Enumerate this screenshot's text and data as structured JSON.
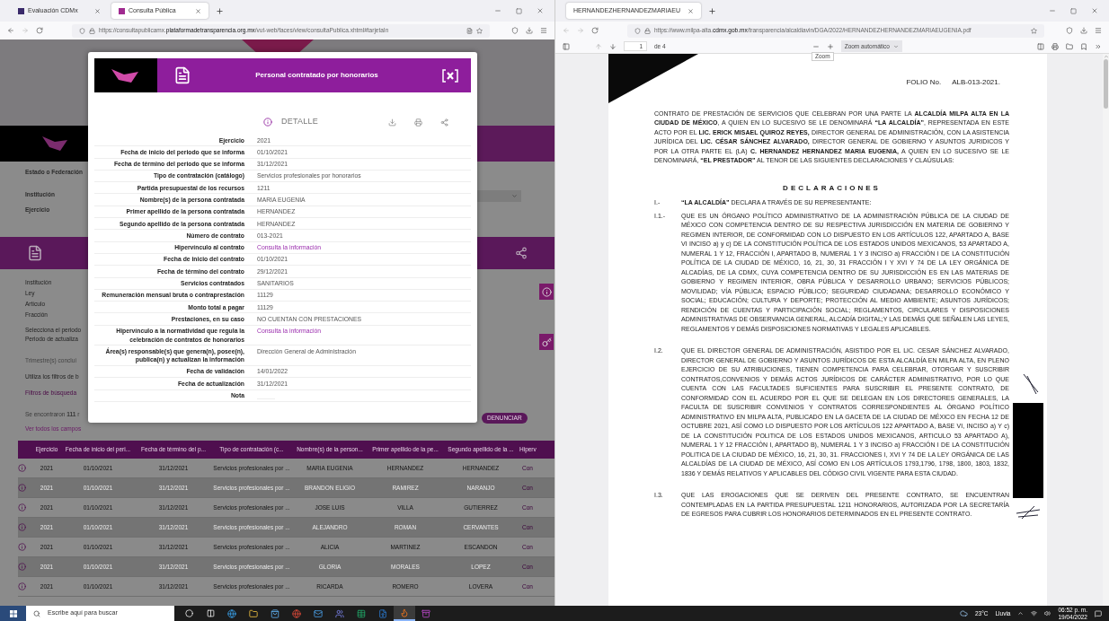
{
  "left_window": {
    "tabs": [
      {
        "label": "Evaluación CDMx",
        "selected": false
      },
      {
        "label": "Consulta Pública",
        "selected": true
      }
    ],
    "address": {
      "prefix": "https://consultapublicamx.",
      "domain": "plataformadetransparencia.org.mx",
      "path": "/vut-web/faces/view/consultaPublica.xhtml#tarjetaIn"
    },
    "page": {
      "filters": [
        "Estado o Federación",
        "Institución",
        "Ejercicio"
      ],
      "info_labels": [
        "Institución",
        "Ley",
        "Artículo",
        "Fracción"
      ],
      "period_lines": [
        "Selecciona el periodo",
        "Periodo de actualiza"
      ],
      "notes": [
        {
          "text": "Trimestre(s) conclui",
          "kind": "muted"
        },
        {
          "text": "Utiliza los filtros de b",
          "kind": "plain"
        },
        {
          "text": "Filtros de búsqueda",
          "kind": "link"
        }
      ],
      "results": "Se encontraron **111** r",
      "report_button": "DENUNCIAR",
      "view_all_link": "Ver todos los campos",
      "table": {
        "columns": [
          "Ejercicio",
          "Fecha de inicio del peri...",
          "Fecha de término del p...",
          "Tipo de contratación (c...",
          "Nombre(s) de la person...",
          "Primer apellido de la pe...",
          "Segundo apellido de la ...",
          "Hiperv"
        ],
        "rows": [
          {
            "faded": false,
            "cells": [
              "2021",
              "01/10/2021",
              "31/12/2021",
              "Servicios profesionales por ...",
              "MARIA EUGENIA",
              "HERNANDEZ",
              "HERNANDEZ",
              "Con"
            ]
          },
          {
            "faded": true,
            "cells": [
              "2021",
              "01/10/2021",
              "31/12/2021",
              "Servicios profesionales por ...",
              "BRANDON ELIGIO",
              "RAMIREZ",
              "NARANJO",
              "Con"
            ]
          },
          {
            "faded": false,
            "cells": [
              "2021",
              "01/10/2021",
              "31/12/2021",
              "Servicios profesionales por ...",
              "JOSE LUIS",
              "VILLA",
              "GUTIERREZ",
              "Con"
            ]
          },
          {
            "faded": true,
            "cells": [
              "2021",
              "01/10/2021",
              "31/12/2021",
              "Servicios profesionales por ...",
              "ALEJANDRO",
              "ROMAN",
              "CERVANTES",
              "Con"
            ]
          },
          {
            "faded": false,
            "cells": [
              "2021",
              "01/10/2021",
              "31/12/2021",
              "Servicios profesionales por ...",
              "ALICIA",
              "MARTINEZ",
              "ESCANDON",
              "Con"
            ]
          },
          {
            "faded": true,
            "cells": [
              "2021",
              "01/10/2021",
              "31/12/2021",
              "Servicios profesionales por ...",
              "GLORIA",
              "MORALES",
              "LOPEZ",
              "Con"
            ]
          },
          {
            "faded": false,
            "cells": [
              "2021",
              "01/10/2021",
              "31/12/2021",
              "Servicios profesionales por ...",
              "RICARDA",
              "ROMERO",
              "LOVERA",
              "Con"
            ]
          }
        ]
      }
    },
    "modal": {
      "title": "Personal contratado por honorarios",
      "detail_heading": "DETALLE",
      "fields": [
        {
          "label": "Ejercicio",
          "value": "2021",
          "kind": "text"
        },
        {
          "label": "Fecha de inicio del periodo que se informa",
          "value": "01/10/2021",
          "kind": "text"
        },
        {
          "label": "Fecha de término del periodo que se informa",
          "value": "31/12/2021",
          "kind": "text"
        },
        {
          "label": "Tipo de contratación (catálogo)",
          "value": "Servicios profesionales por honorarios",
          "kind": "text"
        },
        {
          "label": "Partida presupuestal de los recursos",
          "value": "1211",
          "kind": "text"
        },
        {
          "label": "Nombre(s) de la persona contratada",
          "value": "MARIA EUGENIA",
          "kind": "text"
        },
        {
          "label": "Primer apellido de la persona contratada",
          "value": "HERNANDEZ",
          "kind": "text"
        },
        {
          "label": "Segundo apellido de la persona contratada",
          "value": "HERNANDEZ",
          "kind": "text"
        },
        {
          "label": "Número de contrato",
          "value": "013-2021",
          "kind": "text"
        },
        {
          "label": "Hipervínculo al contrato",
          "value": "Consulta la información",
          "kind": "link"
        },
        {
          "label": "Fecha de inicio del contrato",
          "value": "01/10/2021",
          "kind": "text"
        },
        {
          "label": "Fecha de término del contrato",
          "value": "29/12/2021",
          "kind": "text"
        },
        {
          "label": "Servicios contratados",
          "value": "SANITARIOS",
          "kind": "text"
        },
        {
          "label": "Remuneración mensual bruta o contraprestación",
          "value": "11129",
          "kind": "text"
        },
        {
          "label": "Monto total a pagar",
          "value": "11129",
          "kind": "text"
        },
        {
          "label": "Prestaciones, en su caso",
          "value": "NO CUENTAN CON PRESTACIONES",
          "kind": "text"
        },
        {
          "label": "Hipervínculo a la normatividad que regula la celebración de contratos de honorarios",
          "value": "Consulta la información",
          "kind": "link"
        },
        {
          "label": "Área(s) responsable(s) que genera(n), posee(n), publica(n) y actualizan la información",
          "value": "Dirección General de Administración",
          "kind": "text"
        },
        {
          "label": "Fecha de validación",
          "value": "14/01/2022",
          "kind": "text"
        },
        {
          "label": "Fecha de actualización",
          "value": "31/12/2021",
          "kind": "text"
        },
        {
          "label": "Nota",
          "kind": "text"
        }
      ]
    }
  },
  "right_window": {
    "tabs": [
      {
        "label": "HERNANDEZHERNANDEZMARIAEU",
        "selected": true
      }
    ],
    "address": {
      "prefix": "https://www.milpa-alta.",
      "domain": "cdmx.gob.mx",
      "path": "/transparencia/alcaldiavin/DGA/2022/HERNANDEZHERNANDEZMARIAEUGENIA.pdf"
    },
    "pdf_toolbar": {
      "page": "1",
      "page_count": "de 4",
      "zoom": "Zoom automático",
      "tooltip": "Zoom"
    },
    "document": {
      "folio_label": "FOLIO No.",
      "folio": "ALB-013-2021.",
      "intro": "CONTRATO DE PRESTACIÓN DE SERVICIOS QUE CELEBRAN POR UNA PARTE LA **ALCALDÍA MILPA ALTA EN LA CIUDAD DE MÉXICO**, A QUIEN EN LO SUCESIVO SE LE DENOMINARÁ **“LA ALCALDÍA”**, REPRESENTADA EN ESTE ACTO POR EL **LIC. ERICK MISAEL QUIROZ REYES,** DIRECTOR GENERAL DE ADMINISTRACIÓN, CON LA ASISTENCIA JURÍDICA DEL **LIC. CÉSAR SÁNCHEZ ALVARADO,** DIRECTOR GENERAL DE GOBIERNO Y ASUNTOS JURIDICOS Y POR LA OTRA PARTE EL (LA) **C. HERNANDEZ HERNANDEZ MARIA EUGENIA,** A QUIEN EN LO SUCESIVO SE LE DENOMINARÁ, **“EL PRESTADOR”** AL TENOR DE LAS SIGUIENTES DECLARACIONES Y CLAÚSULAS:",
      "heading": "DECLARACIONES",
      "sections": [
        {
          "number": "I.-",
          "text": "**“LA ALCALDÍA”** DECLARA A TRAVÉS DE SU REPRESENTANTE:"
        },
        {
          "number": "I.1.-",
          "text": "QUE ES UN ÓRGANO POLÍTICO ADMINISTRATIVO DE LA ADMINISTRACIÓN PÚBLICA DE LA CIUDAD DE MÉXICO CON COMPETENCIA DENTRO DE SU RESPECTIVA JURISDICCIÓN EN MATERIA DE GOBIERNO Y REGIMEN INTERIOR, DE CONFORMIDAD CON LO DISPUESTO EN LOS ARTÍCULOS 122, APARTADO A, BASE VI INCISO a) y c) DE LA CONSTITUCIÓN POLÍTICA DE LOS ESTADOS UNIDOS MEXICANOS, 53 APARTADO A, NUMERAL 1 Y 12, FRACCIÓN I, APARTADO B, NUMERAL 1 Y 3 INCISO a) FRACCIÓN I DE LA CONSTITUCIÓN POLÍTICA DE LA CIUDAD DE MÉXICO, 16, 21, 30, 31 FRACCIÓN I Y XVI Y 74 DE LA LEY ORGÁNICA DE ALCADÍAS, DE LA CDMX, CUYA COMPETENCIA DENTRO DE SU JURISDICCIÓN ES EN LAS MATERIAS DE GOBIERNO Y REGIMEN INTERIOR, OBRA PÚBLICA Y DESARROLLO URBANO; SERVICIOS PÚBLICOS; MOVILIDAD; VÍA PÚBLICA; ESPACIO PÚBLICO; SEGURIDAD CIUDADANA; DESARROLLO ECONÓMICO Y SOCIAL; EDUCACIÓN; CULTURA Y DEPORTE; PROTECCIÓN AL MEDIO AMBIENTE; ASUNTOS JURÍDICOS; RENDICIÓN DE CUENTAS Y PARTICIPACIÓN SOCIAL; REGLAMENTOS, CIRCULARES Y DISPOSICIONES ADMINISTRATIVAS DE OBSERVANCIA GENERAL, ALCADÍA DIGITAL;Y LAS DEMÁS QUE SEÑALEN LAS LEYES, REGLAMENTOS Y DEMÁS DISPOSICIONES NORMATIVAS Y LEGALES APLICABLES."
        },
        {
          "number": "I.2.",
          "text": "QUE EL DIRECTOR GENERAL DE ADMINISTRACIÓN, ASISTIDO POR EL LIC. CESAR SÁNCHEZ ALVARADO, DIRECTOR GENERAL DE GOBIERNO Y ASUNTOS JURÍDICOS DE ESTA ALCALDÍA EN MILPA ALTA, EN PLENO EJERCICIO DE SU ATRIBUCIONES, TIENEN COMPETENCIA PARA CELEBRAR, OTORGAR Y SUSCRIBIR CONTRATOS,CONVENIOS Y DEMÁS ACTOS JURÍDICOS DE CARÁCTER ADMINISTRATIVO, POR LO QUE CUENTA CON LAS FACULTADES SUFICIENTES PARA SUSCRIBIR EL PRESENTE CONTRATO, DE CONFORMIDAD CON EL ACUERDO POR EL QUE SE DELEGAN EN LOS DIRECTORES GENERALES, LA FACULTA DE SUSCRIBIR CONVENIOS Y CONTRATOS CORRESPONDIENTES AL ÓRGANO POLÍTICO ADMINISTRATIVO EN MILPA ALTA, PUBLICADO EN LA GACETA DE LA CIUDAD DE MÉXICO EN FECHA 12 DE OCTUBRE 2021, ASÍ COMO LO DISPUESTO POR LOS ARTÍCULOS 122 APARTADO A, BASE VI, INCISO a) Y c) DE LA CONSTITUCIÓN POLITICA DE LOS ESTADOS UNIDOS MEXICANOS, ARTICULO 53 APARTADO A), NUMERAL 1 Y 12 FRACCIÓN I, APARTADO B), NUMERAL 1 Y 3 INCISO a) FRACCIÓN I DE LA CONSTITUCIÓN POLITICA DE LA CIUDAD DE MÉXICO, 16, 21, 30, 31. FRACCIONES I, XVI Y 74 DE LA LEY ORGÁNICA DE LAS ALCALDÍAS DE LA CIUDAD DE MÉXICO, ASÍ COMO EN LOS ARTÍCULOS 1793,1796, 1798, 1800, 1803, 1832, 1836 Y DEMÁS RELATIVOS Y APLICABLES DEL CÓDIGO CIVIL VIGENTE PARA ESTA CIUDAD."
        },
        {
          "number": "I.3.",
          "text": "QUE LAS EROGACIONES QUE SE DERIVEN DEL PRESENTE CONTRATO, SE ENCUENTRAN CONTEMPLADAS EN LA PARTIDA PRESUPUESTAL 1211 HONORARIOS, AUTORIZADA POR LA SECRETARÍA DE EGRESOS PARA CUBRIR LOS HONORARIOS DETERMINADOS EN EL PRESENTE CONTRATO."
        }
      ]
    }
  },
  "taskbar": {
    "search_placeholder": "Escribe aquí para buscar",
    "apps": [
      {
        "kind": "circle",
        "selected": false
      },
      {
        "kind": "taskview",
        "selected": false
      },
      {
        "kind": "browser",
        "selected": false
      },
      {
        "kind": "folder",
        "selected": false
      },
      {
        "kind": "store",
        "selected": false
      },
      {
        "kind": "globe",
        "selected": false
      },
      {
        "kind": "mail",
        "selected": false
      },
      {
        "kind": "chat",
        "selected": false
      },
      {
        "kind": "sheet",
        "selected": false
      },
      {
        "kind": "doc",
        "selected": false
      },
      {
        "kind": "fox",
        "selected": true
      },
      {
        "kind": "archive",
        "selected": false
      }
    ],
    "temperature": "23°C",
    "weather": "Lluvia",
    "time": "06:52 p. m.",
    "date": "19/04/2022"
  }
}
